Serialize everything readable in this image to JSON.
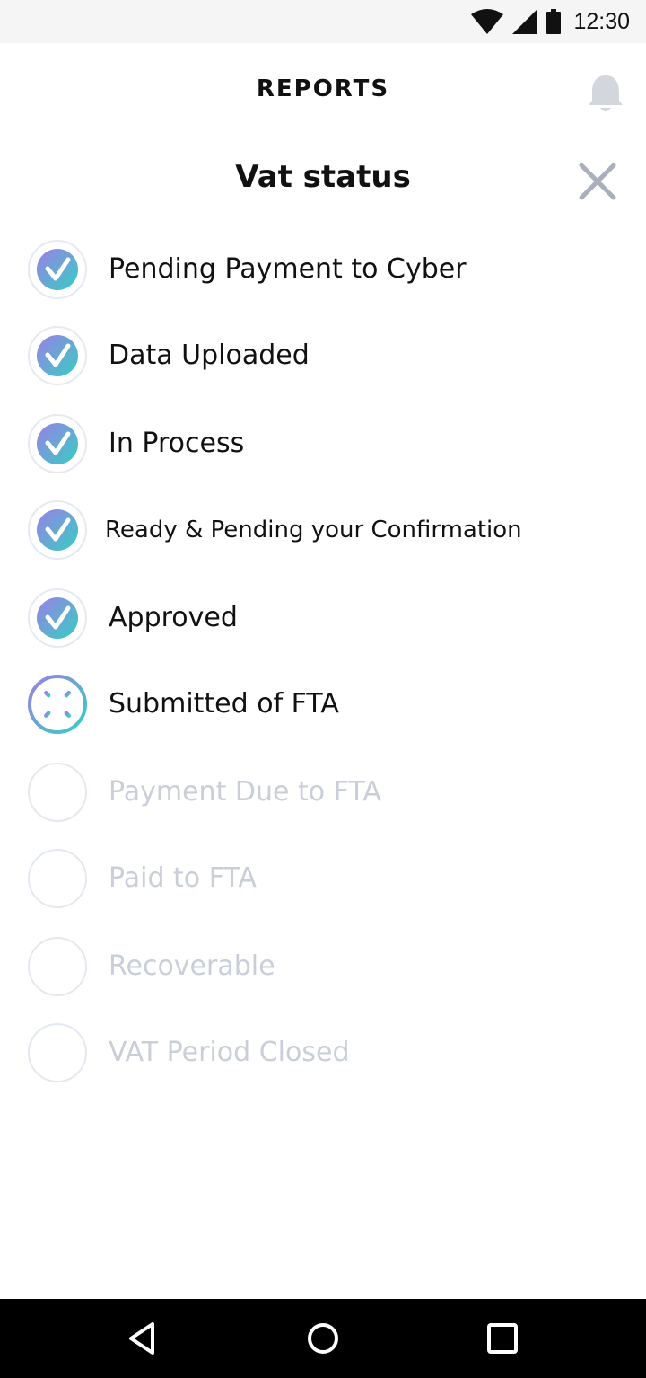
{
  "status_bar": {
    "time": "12:30"
  },
  "header": {
    "title": "REPORTS",
    "notification_icon": "bell-icon"
  },
  "sheet": {
    "title": "Vat status",
    "close_icon": "close-icon"
  },
  "statuses": [
    {
      "label": "Pending Payment to Cyber",
      "state": "done"
    },
    {
      "label": "Data Uploaded",
      "state": "done"
    },
    {
      "label": "In Process",
      "state": "done"
    },
    {
      "label": "Ready & Pending your Confirmation",
      "state": "done"
    },
    {
      "label": "Approved",
      "state": "done"
    },
    {
      "label": "Submitted of FTA",
      "state": "in-progress"
    },
    {
      "label": "Payment Due to FTA",
      "state": "pending"
    },
    {
      "label": "Paid to FTA",
      "state": "pending"
    },
    {
      "label": "Recoverable",
      "state": "pending"
    },
    {
      "label": "VAT Period Closed",
      "state": "pending"
    }
  ],
  "colors": {
    "gradient_start": "#8b7fe8",
    "gradient_end": "#3ccdc4",
    "pending_text": "#c9ced8",
    "pending_ring": "#e4e8f2"
  },
  "nav": {
    "back_icon": "back-triangle-icon",
    "home_icon": "home-circle-icon",
    "recents_icon": "recents-square-icon"
  }
}
